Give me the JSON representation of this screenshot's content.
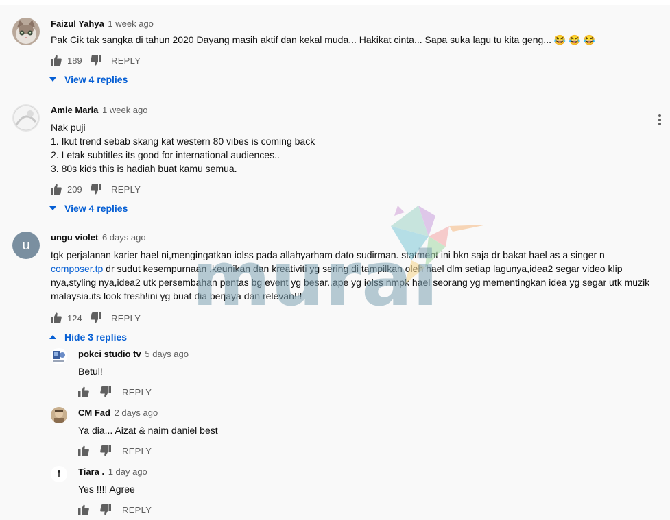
{
  "comments": [
    {
      "author": "Faizul Yahya",
      "time": "1 week ago",
      "text": "Pak Cik tak sangka di tahun 2020 Dayang masih aktif dan kekal muda... Hakikat cinta... Sapa suka lagu tu kita geng... 😂 😂 😂",
      "likes": "189",
      "reply_label": "REPLY",
      "toggle_label": "View 4 replies",
      "avatar_icon": "cat-avatar-icon"
    },
    {
      "author": "Amie Maria",
      "time": "1 week ago",
      "lines": [
        "Nak puji",
        "1. Ikut trend sebab skang kat western 80 vibes is coming back",
        "2. Letak subtitles its good for international audiences..",
        "3. 80s kids this is hadiah buat kamu semua."
      ],
      "likes": "209",
      "reply_label": "REPLY",
      "toggle_label": "View 4 replies",
      "avatar_icon": "photo-avatar-icon"
    },
    {
      "author": "ungu violet",
      "time": "6 days ago",
      "avatar_letter": "u",
      "line1": "tgk perjalanan karier hael ni,mengingatkan iolss pada allahyarham dato sudirman. statment ini bkn saja dr bakat hael as a singer n",
      "link": "composer.tp",
      "line2_rest": " dr sudut kesempurnaan ,keunikan dan kreativiti yg sering di tampilkan oleh hael dlm setiap lagunya,idea2 segar video klip",
      "line3": "nya,styling nya,idea2 utk persembahan pentas bg event yg besar..ape yg iolss nmpk hael seorang yg mementingkan idea yg segar utk muzik",
      "line4": "malaysia.its look fresh!ini yg buat dia berjaya dan relevan!!!",
      "likes": "124",
      "reply_label": "REPLY",
      "toggle_label": "Hide 3 replies"
    }
  ],
  "replies": [
    {
      "author": "pokci studio tv",
      "time": "5 days ago",
      "text": "Betul!",
      "reply_label": "REPLY"
    },
    {
      "author": "CM Fad",
      "time": "2 days ago",
      "text": "Ya dia... Aizat & naim daniel best",
      "reply_label": "REPLY"
    },
    {
      "author": "Tiara .",
      "time": "1 day ago",
      "text": "Yes !!!! Agree",
      "reply_label": "REPLY"
    }
  ],
  "watermark": {
    "text": "murai"
  },
  "colors": {
    "link": "#065fd4",
    "secondary": "#606060",
    "avatar_u": "#7a8fa0"
  }
}
